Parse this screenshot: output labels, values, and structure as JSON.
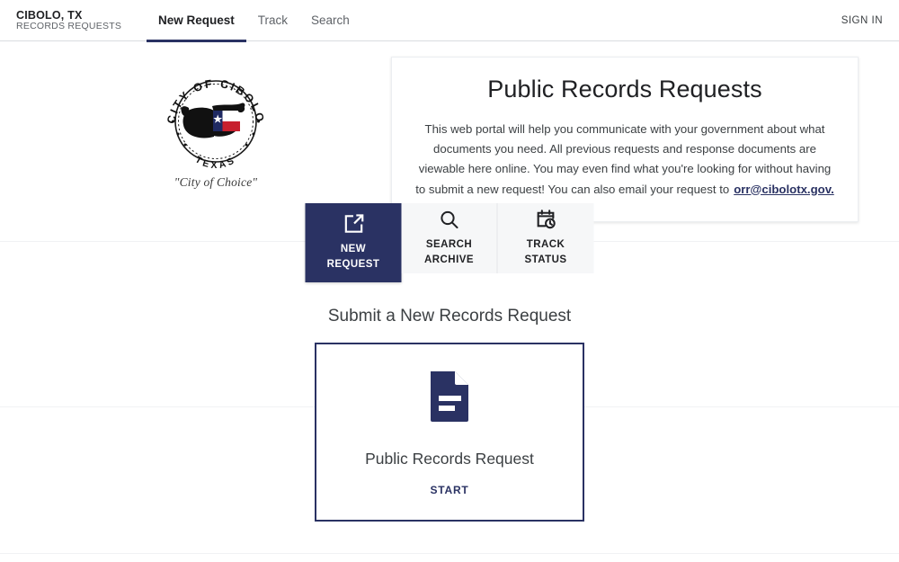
{
  "header": {
    "brand_title": "CIBOLO, TX",
    "brand_subtitle": "RECORDS REQUESTS",
    "nav": [
      {
        "label": "New Request",
        "active": true
      },
      {
        "label": "Track",
        "active": false
      },
      {
        "label": "Search",
        "active": false
      }
    ],
    "sign_in_label": "SIGN IN"
  },
  "seal": {
    "top_arc_text": "CITY OF CIBOLO",
    "bottom_arc_text": "TEXAS",
    "tagline": "\"City of Choice\""
  },
  "info_card": {
    "title": "Public Records Requests",
    "body": "This web portal will help you communicate with your government about what documents you need. All previous requests and response documents are viewable here online. You may even find what you're looking for without having to submit a new request!  You can also email your request to",
    "email_link": "orr@cibolotx.gov."
  },
  "tabs": [
    {
      "label_line1": "NEW",
      "label_line2": "REQUEST",
      "icon": "edit-square-icon",
      "active": true
    },
    {
      "label_line1": "SEARCH",
      "label_line2": "ARCHIVE",
      "icon": "search-icon",
      "active": false
    },
    {
      "label_line1": "TRACK",
      "label_line2": "STATUS",
      "icon": "calendar-clock-icon",
      "active": false
    }
  ],
  "main": {
    "section_title": "Submit a New Records Request",
    "card": {
      "icon": "document-icon",
      "name": "Public Records Request",
      "start_label": "START"
    }
  },
  "colors": {
    "navy": "#2a3263",
    "tab_inactive_bg": "#f6f7f8",
    "text": "#3c4043",
    "muted": "#5f6368",
    "border": "#dadce0"
  }
}
